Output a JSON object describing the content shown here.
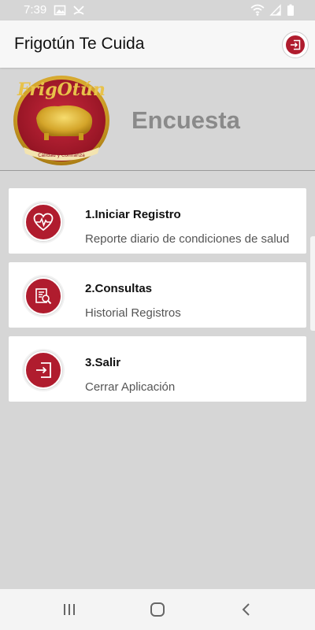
{
  "status_bar": {
    "time": "7:39"
  },
  "app_bar": {
    "title": "Frigotún Te Cuida"
  },
  "header": {
    "logo_text": "FrigOtún",
    "logo_tagline": "Calidad y Confianza",
    "heading": "Encuesta"
  },
  "menu": {
    "items": [
      {
        "title": "1.Iniciar Registro",
        "subtitle": "Reporte diario de condiciones de salud",
        "icon": "heart-rate-icon"
      },
      {
        "title": "2.Consultas",
        "subtitle": "Historial Registros",
        "icon": "document-search-icon"
      },
      {
        "title": "3.Salir",
        "subtitle": "Cerrar Aplicación",
        "icon": "exit-icon"
      }
    ]
  },
  "colors": {
    "brand_red": "#b01c2e",
    "background": "#d6d6d6",
    "heading_gray": "#8a8a8a"
  }
}
